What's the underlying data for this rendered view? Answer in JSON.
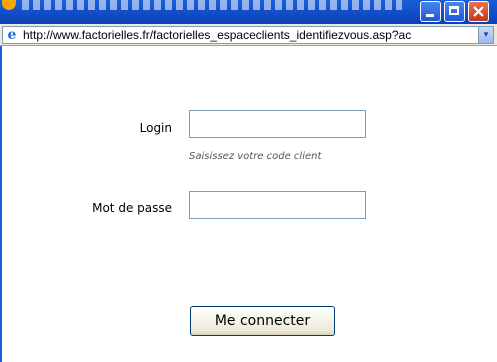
{
  "browser": {
    "address_url": "http://www.factorielles.fr/factorielles_espaceclients_identifiezvous.asp?ac",
    "dropdown_glyph": "▾",
    "ie_glyph": "e"
  },
  "form": {
    "login_label": "Login",
    "login_value": "",
    "login_hint": "Saisissez votre code client",
    "password_label": "Mot de passe",
    "password_value": "",
    "submit_label": "Me connecter"
  },
  "colors": {
    "titlebar": "#1a5fd8",
    "close_button": "#c2371a",
    "input_border": "#7f9db9"
  },
  "icons": [
    "minimize-icon",
    "maximize-icon",
    "close-icon",
    "ie-logo-icon",
    "dropdown-arrow-icon"
  ]
}
